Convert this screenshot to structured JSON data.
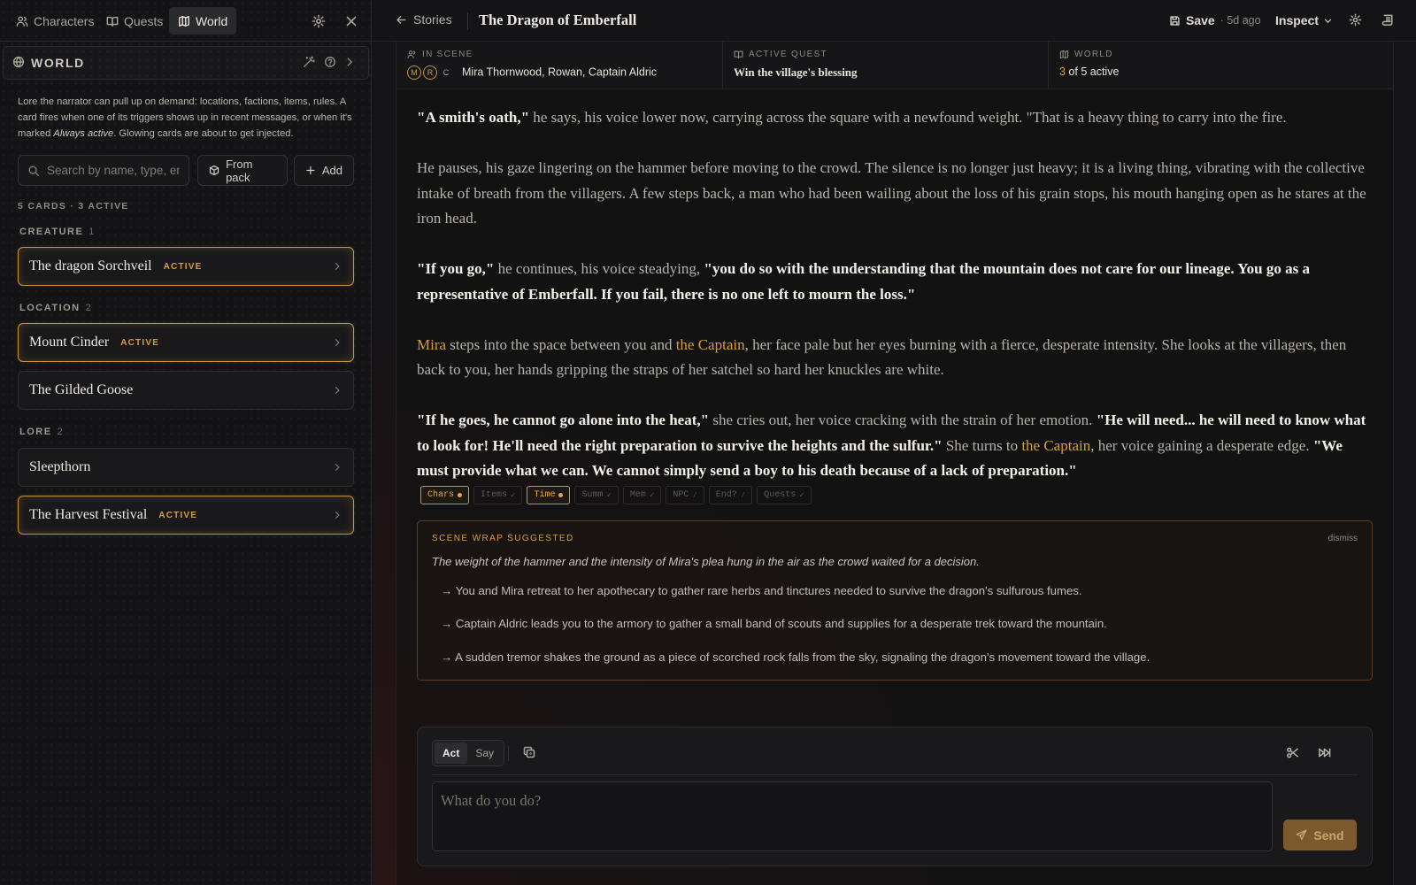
{
  "sidebar": {
    "tabs": [
      {
        "label": "Characters",
        "icon": "users-icon"
      },
      {
        "label": "Quests",
        "icon": "book-icon"
      },
      {
        "label": "World",
        "icon": "map-icon",
        "active": true
      }
    ],
    "panel_title": "WORLD",
    "description_parts": [
      "Lore the narrator can pull up on demand: locations, factions, items, rules. A card fires when one of its triggers shows up in recent messages, or when it's marked ",
      "Always active",
      ". Glowing cards are about to get injected."
    ],
    "search_placeholder": "Search by name, type, entry",
    "from_pack_label": "From pack",
    "add_label": "Add",
    "count_label": "5 CARDS · 3 ACTIVE",
    "groups": [
      {
        "label": "CREATURE",
        "count": "1",
        "cards": [
          {
            "name": "The dragon Sorchveil",
            "badge": "ACTIVE"
          }
        ]
      },
      {
        "label": "LOCATION",
        "count": "2",
        "cards": [
          {
            "name": "Mount Cinder",
            "badge": "ACTIVE"
          },
          {
            "name": "The Gilded Goose",
            "badge": ""
          }
        ]
      },
      {
        "label": "LORE",
        "count": "2",
        "cards": [
          {
            "name": "Sleepthorn",
            "badge": ""
          },
          {
            "name": "The Harvest Festival",
            "badge": "ACTIVE"
          }
        ]
      }
    ]
  },
  "header": {
    "back_label": "Stories",
    "title": "The Dragon of Emberfall",
    "save_label": "Save",
    "save_ago": "· 5d ago",
    "inspect_label": "Inspect"
  },
  "info": {
    "in_scene_label": "IN SCENE",
    "avatars": [
      "M",
      "R",
      "C"
    ],
    "in_scene_value": "Mira Thornwood, Rowan, Captain Aldric",
    "quest_label": "ACTIVE QUEST",
    "quest_value": "Win the village's blessing",
    "world_label": "WORLD",
    "world_active": "3",
    "world_rest": " of 5 active"
  },
  "story": {
    "p1": [
      "\"A smith's oath,\"",
      " he says, his voice lower now, carrying across the square with a newfound weight. \"That is a heavy thing to carry into the fire."
    ],
    "p2": "He pauses, his gaze lingering on the hammer before moving to the crowd. The silence is no longer just heavy; it is a living thing, vibrating with the collective intake of breath from the villagers. A few steps back, a man who had been wailing about the loss of his grain stops, his mouth hanging open as he stares at the iron head.",
    "p3": [
      "\"If you go,\"",
      " he continues, his voice steadying, ",
      "\"you do so with the understanding that the mountain does not care for our lineage. You go as a representative of Emberfall. If you fail, there is no one left to mourn the loss.\""
    ],
    "p4": [
      "Mira",
      " steps into the space between you and ",
      "the Captain",
      ", her face pale but her eyes burning with a fierce, desperate intensity. She looks at the villagers, then back to you, her hands gripping the straps of her satchel so hard her knuckles are white."
    ],
    "p5": [
      "\"If he goes, he cannot go alone into the heat,\"",
      " she cries out, her voice cracking with the strain of her emotion. ",
      "\"He will need... he will need to know what to look for! He'll need the right preparation to survive the heights and the sulfur.\"",
      " She turns to ",
      "the Captain",
      ", her voice gaining a desperate edge. ",
      "\"We must provide what we can. We cannot simply send a boy to his death because of a lack of preparation.\""
    ]
  },
  "trackers": [
    {
      "label": "Chars",
      "state": "on"
    },
    {
      "label": "Items",
      "state": "check"
    },
    {
      "label": "Time",
      "state": "on"
    },
    {
      "label": "Summ",
      "state": "check"
    },
    {
      "label": "Mem",
      "state": "check"
    },
    {
      "label": "NPC",
      "state": "slash"
    },
    {
      "label": "End?",
      "state": "slash"
    },
    {
      "label": "Quests",
      "state": "check"
    }
  ],
  "scene_wrap": {
    "title": "SCENE WRAP SUGGESTED",
    "dismiss": "dismiss",
    "summary": "The weight of the hammer and the intensity of Mira's plea hung in the air as the crowd waited for a decision.",
    "options": [
      "→ You and Mira retreat to her apothecary to gather rare herbs and tinctures needed to survive the dragon's sulfurous fumes.",
      "→ Captain Aldric leads you to the armory to gather a small band of scouts and supplies for a desperate trek toward the mountain.",
      "→ A sudden tremor shakes the ground as a piece of scorched rock falls from the sky, signaling the dragon's movement toward the village."
    ]
  },
  "composer": {
    "mode_act": "Act",
    "mode_say": "Say",
    "placeholder": "What do you do?",
    "send_label": "Send"
  },
  "colors": {
    "accent": "#d79d3c",
    "border_active": "#c8923b",
    "send_bg": "#7a5a2d"
  }
}
